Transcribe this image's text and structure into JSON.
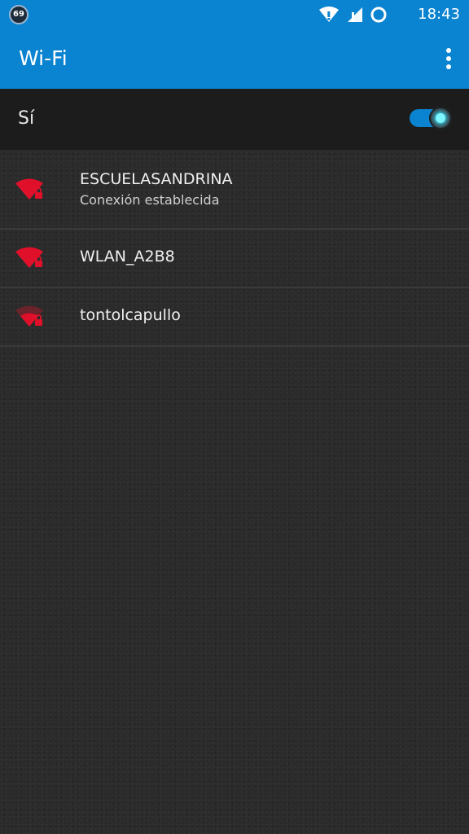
{
  "status_bar": {
    "badge_count": "69",
    "time": "18:43",
    "icons": [
      "wifi-alert-icon",
      "cell-signal-alert-icon",
      "sync-ring-icon"
    ]
  },
  "app_bar": {
    "title": "Wi-Fi",
    "menu_icon": "more-vert-icon"
  },
  "master_switch": {
    "label": "Sí",
    "state": "on"
  },
  "networks": [
    {
      "ssid": "ESCUELASANDRINA",
      "status": "Conexión establecida",
      "icon": "wifi-lock-icon",
      "signal": "full"
    },
    {
      "ssid": "WLAN_A2B8",
      "status": "",
      "icon": "wifi-lock-icon",
      "signal": "full"
    },
    {
      "ssid": "tontolcapullo",
      "status": "",
      "icon": "wifi-lock-icon",
      "signal": "medium"
    }
  ],
  "colors": {
    "accent": "#0a83d0",
    "wifi_icon": "#e0102a",
    "toggle_glow": "#33e3ff",
    "background": "#2b2b2b"
  }
}
